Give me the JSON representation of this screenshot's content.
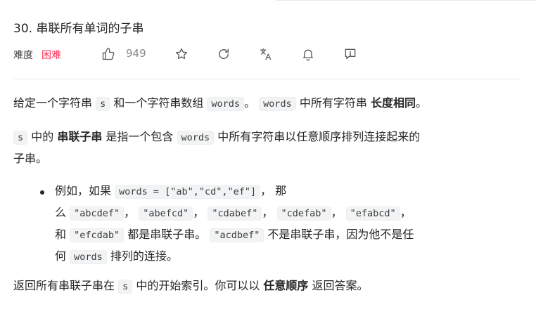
{
  "problem": {
    "title": "30. 串联所有单词的子串",
    "difficulty_label": "难度",
    "difficulty_value": "困难",
    "likes": "949"
  },
  "icons": [
    "thumbs-up-icon",
    "star-icon",
    "refresh-icon",
    "translate-icon",
    "bell-icon",
    "feedback-icon"
  ],
  "colors": {
    "difficulty_hard": "#ff2d55",
    "text": "#262626",
    "code_bg": "#f2f3f4"
  },
  "description": {
    "p1": {
      "t1": "给定一个字符串 ",
      "c1": "s",
      "t2": " 和一个字符串数组 ",
      "c2": "words",
      "t3": "。 ",
      "c3": "words",
      "t4": " 中所有字符串 ",
      "b1": "长度相同",
      "t5": "。"
    },
    "p2": {
      "c1": "s",
      "t1": " 中的 ",
      "b1": "串联子串",
      "t2": " 是指一个包含 ",
      "c2": "words",
      "t3": " 中所有字符串以任意顺序排列连接起来的",
      "line2": "子串。"
    },
    "example": {
      "l1_t1": "例如，如果 ",
      "l1_c1": "words = [\"ab\",\"cd\",\"ef\"]",
      "l1_t2": "， 那",
      "l2_t1": "么 ",
      "l2_c1": "\"abcdef\"",
      "l2_c2": "\"abefcd\"",
      "l2_c3": "\"cdabef\"",
      "l2_c4": "\"cdefab\"",
      "l2_c5": "\"efabcd\"",
      "sep": "，",
      "l3_t1": "和 ",
      "l3_c1": "\"efcdab\"",
      "l3_t2": " 都是串联子串。 ",
      "l3_c2": "\"acdbef\"",
      "l3_t3": " 不是串联子串，因为他不是任",
      "l4_t1": "何 ",
      "l4_c1": "words",
      "l4_t2": " 排列的连接。"
    },
    "p3": {
      "t1": "返回所有串联子串在 ",
      "c1": "s",
      "t2": " 中的开始索引。你可以以 ",
      "b1": "任意顺序",
      "t3": " 返回答案。"
    }
  }
}
